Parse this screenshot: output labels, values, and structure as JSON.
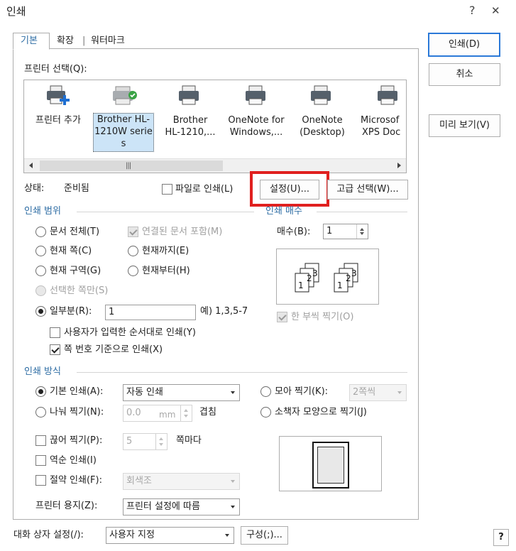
{
  "window": {
    "title": "인쇄",
    "help_glyph": "?",
    "close_glyph": "✕"
  },
  "tabs": [
    {
      "label": "기본",
      "active": true
    },
    {
      "label": "확장",
      "active": false
    },
    {
      "label": "워터마크",
      "active": false
    }
  ],
  "tab_separator": "|",
  "printer_select": {
    "label": "프린터 선택(Q):",
    "items": [
      {
        "label": "프린터 추가",
        "icon": "printer-add-icon"
      },
      {
        "label": "Brother HL-1210W series",
        "icon": "network-printer-icon",
        "selected": true
      },
      {
        "label": "Brother HL-1210,...",
        "icon": "printer-icon"
      },
      {
        "label": "OneNote for Windows,...",
        "icon": "printer-icon"
      },
      {
        "label": "OneNote (Desktop)",
        "icon": "printer-icon"
      },
      {
        "label": "Microsoft XPS Doc",
        "icon": "printer-icon"
      }
    ],
    "brother_w_lines": [
      "Brother HL-",
      "1210W serie",
      "s"
    ],
    "brother_lines": [
      "Brother",
      "HL-1210,..."
    ],
    "onenote_win_lines": [
      "OneNote for",
      "Windows,..."
    ],
    "onenote_desk_lines": [
      "OneNote",
      "(Desktop)"
    ],
    "xps_lines": [
      "Microsof",
      "XPS Doc"
    ],
    "scroll_thumb_glyph": "|||"
  },
  "status": {
    "label": "상태:",
    "value": "준비됨"
  },
  "print_to_file": {
    "label": "파일로 인쇄(L)",
    "checked": false
  },
  "buttons": {
    "print": "인쇄(D)",
    "cancel": "취소",
    "preview": "미리 보기(V)",
    "settings": "설정(U)...",
    "advanced": "고급 선택(W)...",
    "configure": "구성(;)..."
  },
  "print_range": {
    "title": "인쇄 범위",
    "whole_doc": "문서 전체(T)",
    "linked_docs": "연결된 문서 포함(M)",
    "current_page": "현재 쪽(C)",
    "up_to_current": "현재까지(E)",
    "current_section": "현재 구역(G)",
    "from_current": "현재부터(H)",
    "selected_pages": "선택한 쪽만(S)",
    "partial": "일부분(R):",
    "partial_value": "1",
    "partial_example": "예) 1,3,5-7",
    "user_order": "사용자가 입력한 순서대로 인쇄(Y)",
    "page_number_order": "쪽 번호 기준으로 인쇄(X)",
    "page_number_order_checked": true,
    "selected_radio": "partial"
  },
  "copies": {
    "title": "인쇄 매수",
    "label": "매수(B):",
    "value": "1",
    "collate": "한 부씩 찍기(O)",
    "collate_checked": true,
    "collate_pages": [
      "1",
      "2",
      "3"
    ]
  },
  "print_method": {
    "title": "인쇄 방식",
    "basic": "기본 인쇄(A):",
    "basic_value": "자동 인쇄",
    "split": "나눠 찍기(N):",
    "split_value": "0.0",
    "split_unit": "mm",
    "overlap": "겹침",
    "gather": "모아 찍기(K):",
    "gather_value": "2쪽씩",
    "booklet": "소책자 모양으로 찍기(J)",
    "cut": "끊어 찍기(P):",
    "cut_value": "5",
    "per_page": "쪽마다",
    "reverse": "역순 인쇄(I)",
    "save": "절약 인쇄(F):",
    "save_value": "회색조",
    "paper_label": "프린터 용지(Z):",
    "paper_value": "프린터 설정에 따름",
    "selected_radio": "basic"
  },
  "footer": {
    "dialog_setting_label": "대화 상자 설정(/):",
    "dialog_setting_value": "사용자 지정",
    "help_glyph": "?"
  },
  "colors": {
    "accent": "#2e6da4",
    "highlight_box": "#e0201f",
    "selected_item_bg": "#cce4f7"
  }
}
